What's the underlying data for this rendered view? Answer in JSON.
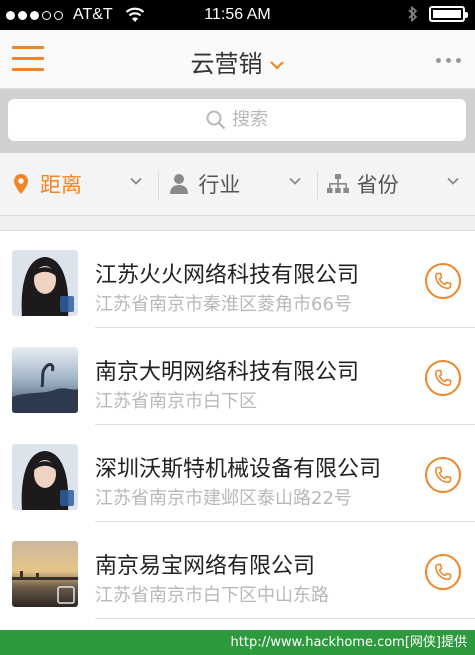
{
  "status_bar": {
    "carrier": "AT&T",
    "time": "11:56 AM",
    "battery_level": 1.0
  },
  "nav": {
    "title": "云营销"
  },
  "search": {
    "placeholder": "搜索"
  },
  "filters": [
    {
      "label": "距离",
      "icon": "location-pin-icon"
    },
    {
      "label": "行业",
      "icon": "person-icon"
    },
    {
      "label": "省份",
      "icon": "hierarchy-icon"
    }
  ],
  "companies": [
    {
      "name": "江苏火火网络科技有限公司",
      "address": "江苏省南京市秦淮区菱角市66号",
      "avatar": "girl-portrait"
    },
    {
      "name": "南京大明网络科技有限公司",
      "address": "江苏省南京市白下区",
      "avatar": "sky-photo"
    },
    {
      "name": "深圳沃斯特机械设备有限公司",
      "address": "江苏省南京市建邺区泰山路22号",
      "avatar": "girl-portrait"
    },
    {
      "name": "南京易宝网络有限公司",
      "address": "江苏省南京市白下区中山东路",
      "avatar": "sunset-pier-photo"
    }
  ],
  "footer": {
    "text": "http://www.hackhome.com[网侠]提供"
  },
  "colors": {
    "accent": "#f08528",
    "footer_bg": "#2e9a3e"
  }
}
